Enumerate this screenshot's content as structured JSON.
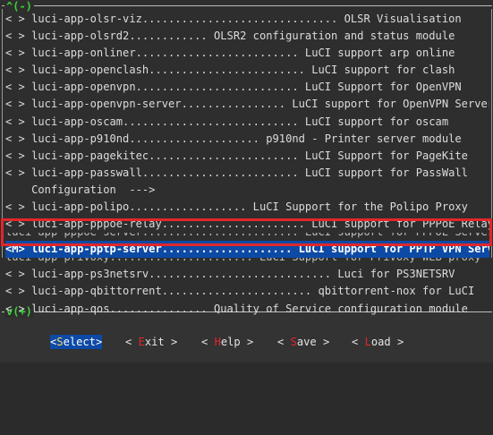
{
  "scroll": {
    "up": "^(-)",
    "down": "v(+)"
  },
  "menu": {
    "items": [
      {
        "mark": "< >",
        "text": "luci-app-olsr-viz.............................. OLSR Visualisation"
      },
      {
        "mark": "< >",
        "text": "luci-app-olsrd2............ OLSR2 configuration and status module"
      },
      {
        "mark": "< >",
        "text": "luci-app-onliner......................... LuCI support arp online"
      },
      {
        "mark": "< >",
        "text": "luci-app-openclash........................ LuCI support for clash"
      },
      {
        "mark": "< >",
        "text": "luci-app-openvpn......................... LuCI Support for OpenVPN"
      },
      {
        "mark": "< >",
        "text": "luci-app-openvpn-server................ LuCI support for OpenVPN Server"
      },
      {
        "mark": "< >",
        "text": "luci-app-oscam........................... LuCI support for oscam"
      },
      {
        "mark": "< >",
        "text": "luci-app-p910nd.................... p910nd - Printer server module"
      },
      {
        "mark": "< >",
        "text": "luci-app-pagekitec....................... LuCI Support for PageKite"
      },
      {
        "mark": "< >",
        "text": "luci-app-passwall........................ LuCI support for PassWall"
      },
      {
        "mark": "   ",
        "text": "Configuration  --->"
      },
      {
        "mark": "< >",
        "text": "luci-app-polipo.................. LuCI Support for the Polipo Proxy"
      },
      {
        "mark": "< >",
        "text": "luci-app-pppoe-relay...................... LuCI support for PPPoE Relay"
      }
    ],
    "ghost_above": "luci-app-pppoe-server........................ LuCI support for PPPoE Server",
    "selected": {
      "mark": "<M>",
      "text": "luci-app-pptp-server.................... LuCI support for PPTP VPN Server"
    },
    "ghost_below": "luci-app-privoxy...................... LuCI Support for Privoxy WEB proxy",
    "items_after": [
      {
        "mark": "< >",
        "text": "luci-app-ps3netsrv............................ Luci for PS3NETSRV"
      },
      {
        "mark": "< >",
        "text": "luci-app-qbittorrent....................... qbittorrent-nox for LuCI"
      },
      {
        "mark": "< >",
        "text": "luci-app-qos............... Quality of Service configuration module"
      }
    ]
  },
  "buttons": {
    "select": {
      "open": "<",
      "hot": "S",
      "rest": "elect",
      "close": ">"
    },
    "exit": {
      "open": "< ",
      "hot": "E",
      "rest": "xit",
      "close": " >"
    },
    "help": {
      "open": "< ",
      "hot": "H",
      "rest": "elp",
      "close": " >"
    },
    "save": {
      "open": "< ",
      "hot": "S",
      "rest": "ave",
      "close": " >"
    },
    "load": {
      "open": "< ",
      "hot": "L",
      "rest": "oad",
      "close": " >"
    }
  },
  "colors": {
    "accent": "#0c4aa6",
    "highlight_box": "#e2262a",
    "scroll_indicator": "#3ad13a"
  }
}
